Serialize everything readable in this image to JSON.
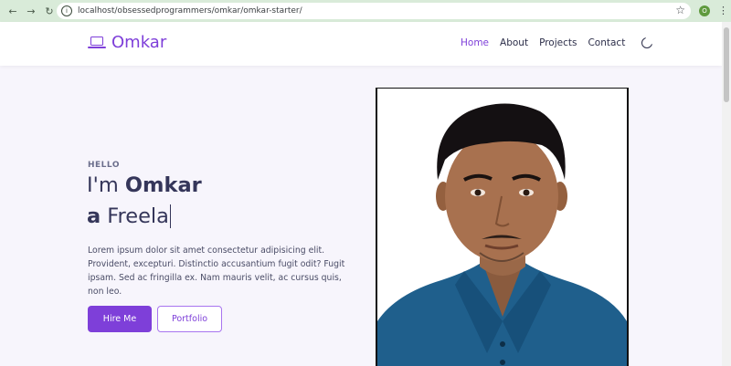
{
  "browser": {
    "url": "localhost/obsessedprogrammers/omkar/omkar-starter/",
    "profile_initial": "O"
  },
  "header": {
    "brand": "Omkar",
    "nav": [
      "Home",
      "About",
      "Projects",
      "Contact"
    ],
    "active_nav": "Home"
  },
  "hero": {
    "greeting": "HELLO",
    "intro_prefix": "I'm",
    "name": "Omkar",
    "role_prefix": "a",
    "typed_text": "Freela",
    "description": "Lorem ipsum dolor sit amet consectetur adipisicing elit. Provident, excepturi. Distinctio accusantium fugit odit? Fugit ipsam. Sed ac fringilla ex. Nam mauris velit, ac cursus quis, non leo.",
    "primary_button": "Hire Me",
    "secondary_button": "Portfolio"
  },
  "colors": {
    "accent": "#7e3fd9",
    "text_dark": "#35365a",
    "page_bg": "#f7f5fc",
    "chrome_bg": "#d9ebd9"
  },
  "icons": {
    "brand": "laptop-icon",
    "theme_toggle": "moon-icon",
    "site_info": "info-icon",
    "bookmark": "star-icon"
  }
}
